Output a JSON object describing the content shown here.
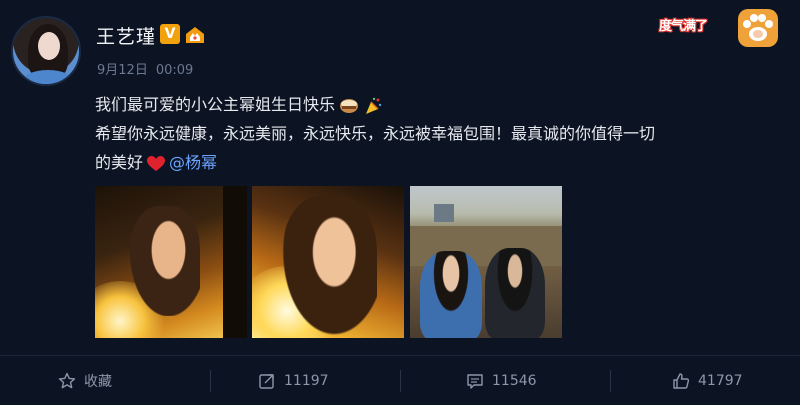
{
  "post": {
    "author": {
      "name": "王艺瑾",
      "verified_badge": "V",
      "member_icon": "crown-house-icon"
    },
    "time": {
      "date": "9月12日",
      "clock": "00:09"
    },
    "sticker": {
      "text": "度气满了",
      "icon": "paw-icon"
    },
    "content": {
      "line1": "我们最可爱的小公主幂姐生日快乐",
      "line2": "希望你永远健康，永远美丽，永远快乐，永远被幸福包围！最真诚的你值得一切",
      "line3": "的美好",
      "mention": "@杨幂",
      "emojis": [
        "cake-emoji",
        "party-popper-emoji",
        "heart-emoji"
      ]
    },
    "photos": [
      {
        "name": "photo-1",
        "tone": "golden portrait"
      },
      {
        "name": "photo-2",
        "tone": "golden portrait close-up"
      },
      {
        "name": "photo-3",
        "tone": "outdoor two people"
      }
    ],
    "actions": {
      "favorite_label": "收藏",
      "repost_count": "11197",
      "comment_count": "11546",
      "like_count": "41797"
    }
  },
  "colors": {
    "background": "#0c1322",
    "mention": "#6ba3ff",
    "verified": "#f2a20c",
    "action_text": "#8c97a9"
  }
}
